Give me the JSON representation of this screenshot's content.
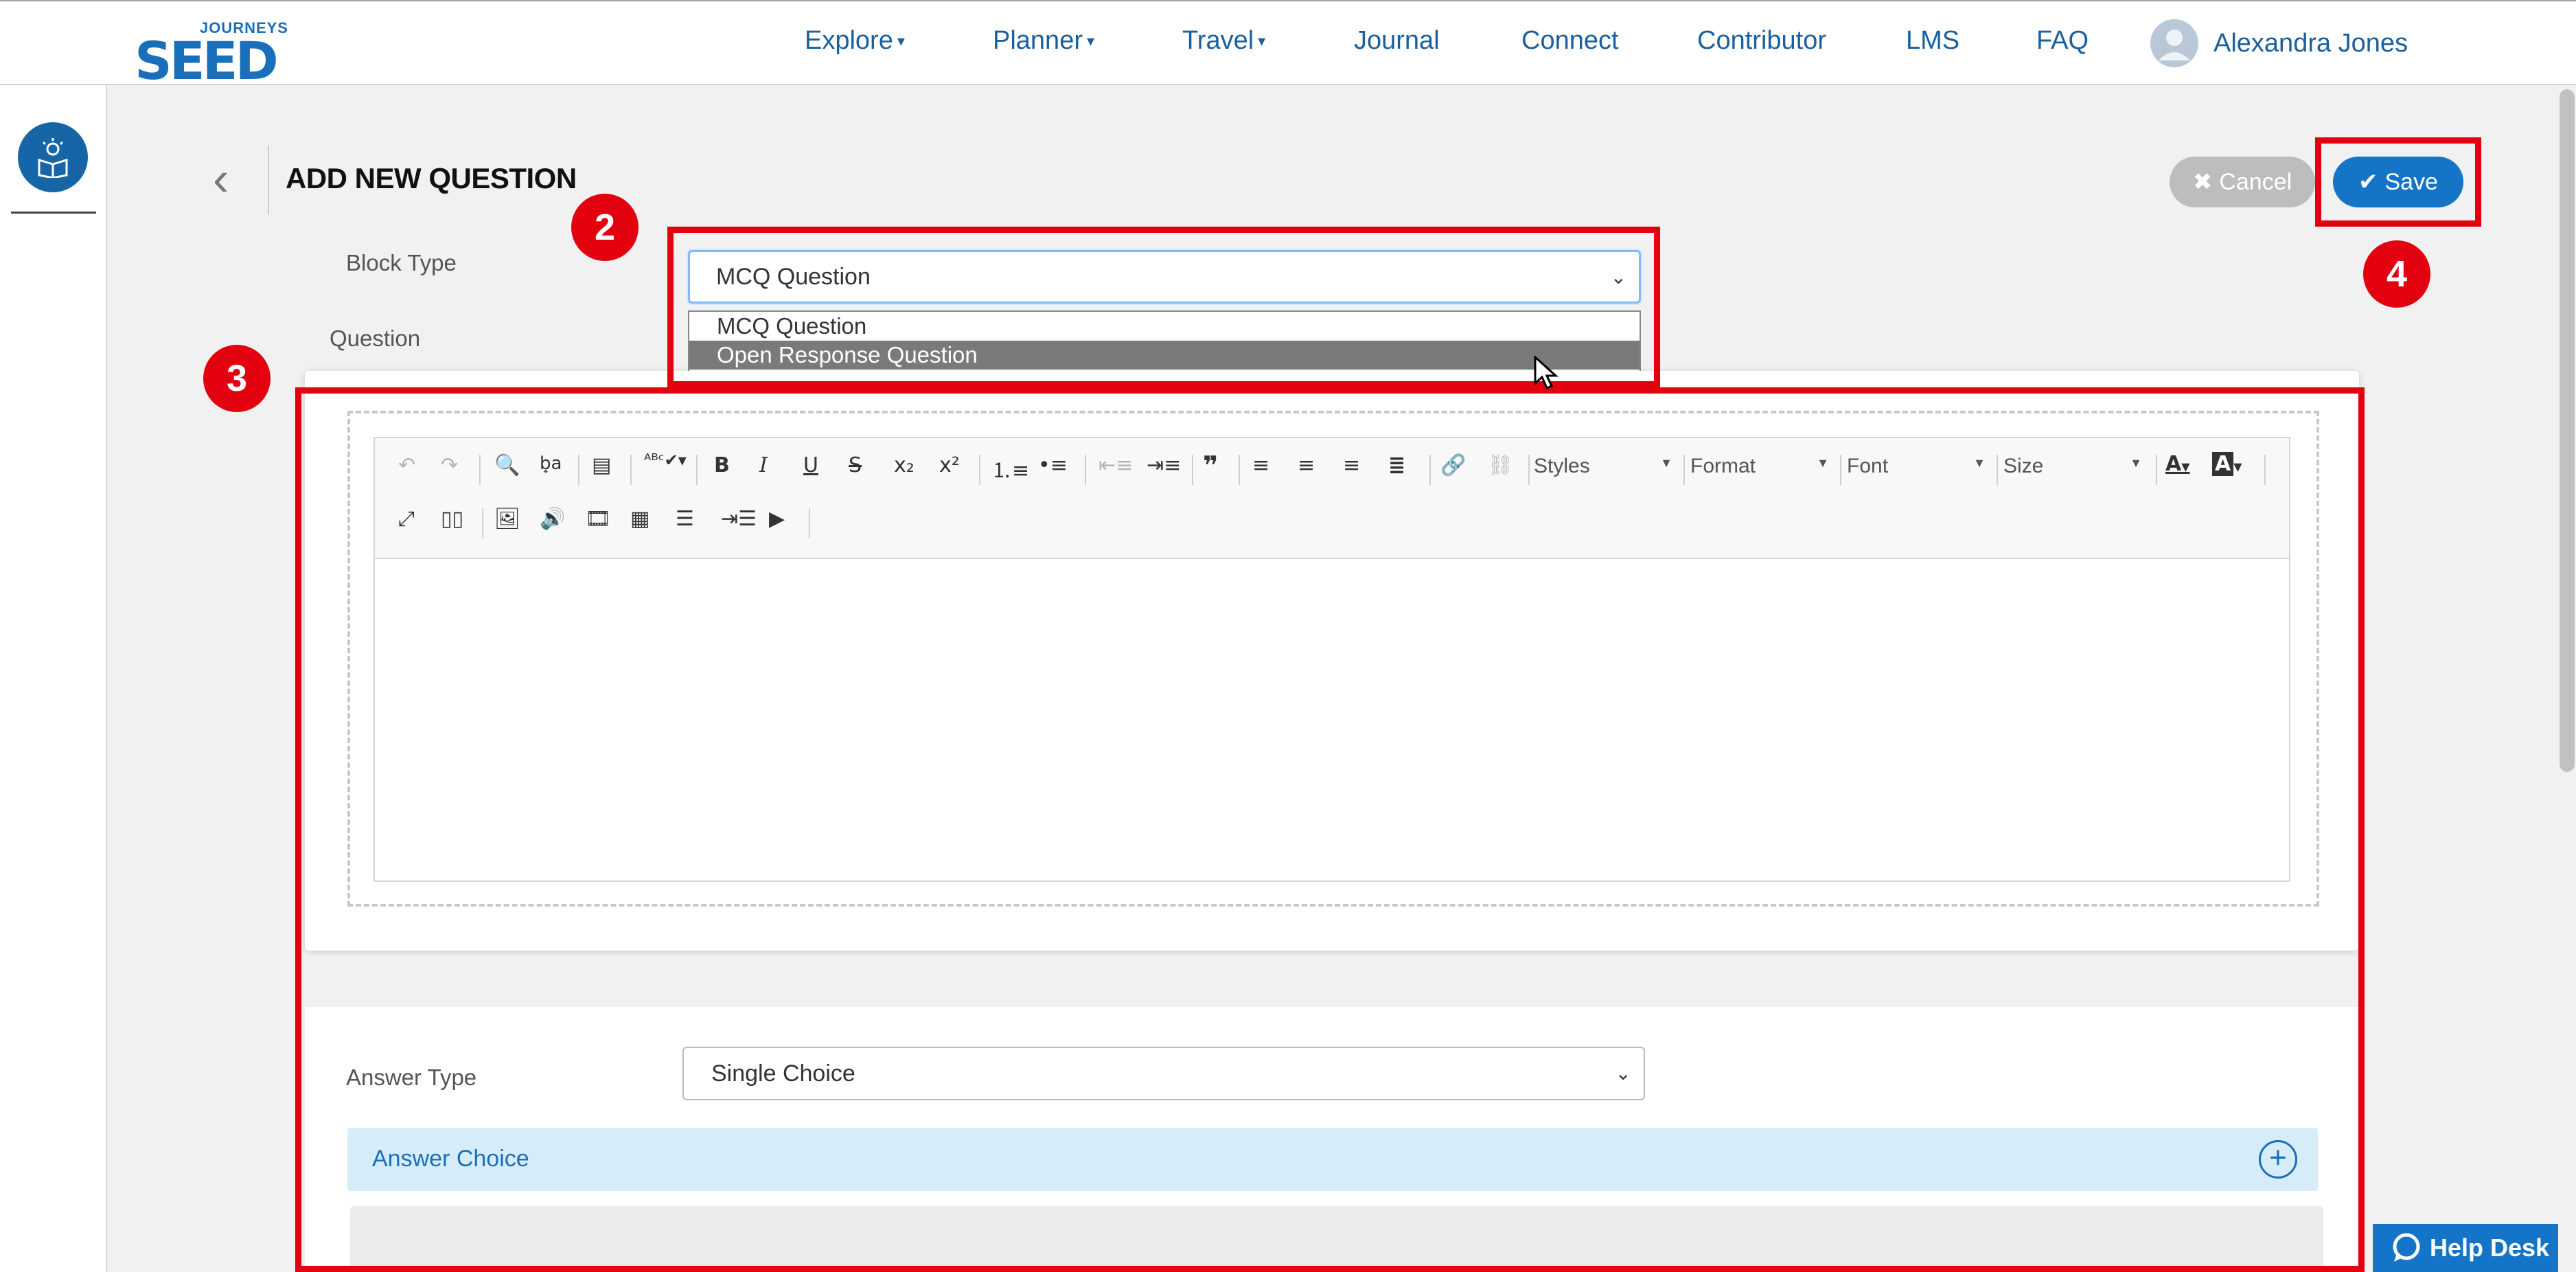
{
  "brand": {
    "logo_top": "JOURNEYS",
    "logo_main": "SEED"
  },
  "nav": {
    "items": [
      {
        "label": "Explore",
        "caret": true
      },
      {
        "label": "Planner",
        "caret": true
      },
      {
        "label": "Travel",
        "caret": true
      },
      {
        "label": "Journal",
        "caret": false
      },
      {
        "label": "Connect",
        "caret": false
      },
      {
        "label": "Contributor",
        "caret": false
      },
      {
        "label": "LMS",
        "caret": false
      },
      {
        "label": "FAQ",
        "caret": false
      }
    ],
    "user_name": "Alexandra Jones"
  },
  "sidebar": {
    "icon": "lightbulb-book-icon"
  },
  "page": {
    "title": "ADD NEW QUESTION"
  },
  "actions": {
    "cancel_label": "Cancel",
    "save_label": "Save"
  },
  "form": {
    "block_type_label": "Block Type",
    "block_type_value": "MCQ Question",
    "block_type_options": [
      "MCQ Question",
      "Open Response Question"
    ],
    "block_type_highlighted": "Open Response Question",
    "question_label": "Question",
    "answer_type_label": "Answer Type",
    "answer_type_value": "Single Choice",
    "answer_choice_label": "Answer Choice"
  },
  "editor": {
    "combos": [
      "Styles",
      "Format",
      "Font",
      "Size"
    ],
    "text_color_glyph": "A",
    "bg_color_glyph": "A"
  },
  "annotations": [
    "2",
    "3",
    "4"
  ],
  "help_desk": {
    "label": "Help Desk"
  },
  "colors": {
    "accent": "#1474c7",
    "annotation_red": "#e3000f",
    "nav_text": "#1a5f9e"
  }
}
